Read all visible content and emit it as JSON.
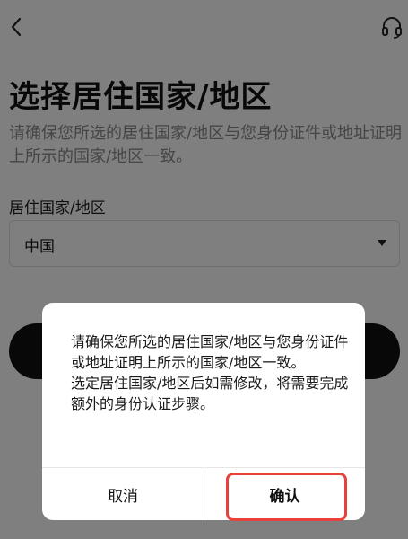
{
  "header": {
    "back_icon": "chevron-left-icon",
    "help_icon": "headset-icon"
  },
  "main": {
    "title": "选择居住国家/地区",
    "subtitle": "请确保您所选的居住国家/地区与您身份证件或地址证明上所示的国家/地区一致。",
    "field_label": "居住国家/地区",
    "selected_value": "中国",
    "dropdown_icon": "caret-down-icon"
  },
  "dialog": {
    "message_line1": "请确保您所选的居住国家/地区与您身份证件或地址证明上所示的国家/地区一致。",
    "message_line2": "选定居住国家/地区后如需修改，将需要完成额外的身份认证步骤。",
    "cancel_label": "取消",
    "confirm_label": "确认"
  },
  "colors": {
    "highlight": "#e8413c",
    "overlay": "rgba(0,0,0,0.5)",
    "primary_button": "#111111"
  }
}
